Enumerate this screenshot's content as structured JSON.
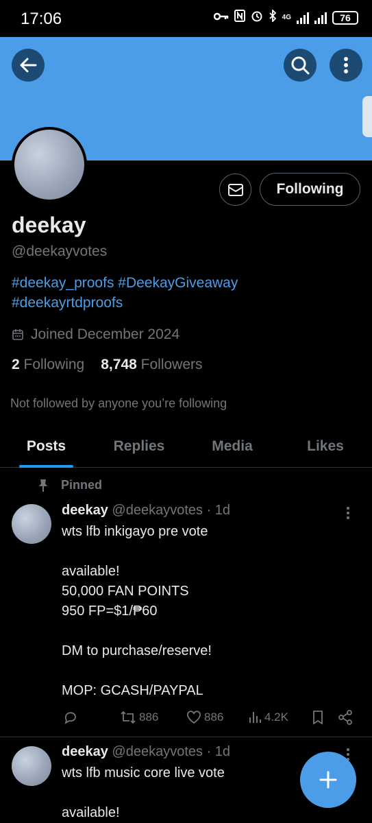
{
  "status_bar": {
    "time": "17:06",
    "network": "4G",
    "battery": "76"
  },
  "profile": {
    "name": "deekay",
    "handle": "@deekayvotes",
    "bio_line1": "#deekay_proofs #DeekayGiveaway",
    "bio_line2": "#deekayrtdproofs",
    "joined": "Joined December 2024",
    "following_count": "2",
    "following_label": "Following",
    "followers_count": "8,748",
    "followers_label": "Followers",
    "not_followed_text": "Not followed by anyone you’re following",
    "follow_button_label": "Following"
  },
  "tabs": [
    "Posts",
    "Replies",
    "Media",
    "Likes"
  ],
  "pinned_label": "Pinned",
  "posts": [
    {
      "name": "deekay",
      "handle": "@deekayvotes",
      "time": "· 1d",
      "text": "wts lfb inkigayo pre vote\n\navailable!\n50,000 FAN POINTS\n950 FP=$1/₱60\n\nDM to purchase/reserve!\n\nMOP: GCASH/PAYPAL",
      "reposts": "886",
      "likes": "886",
      "views": "4.2K"
    },
    {
      "name": "deekay",
      "handle": "@deekayvotes",
      "time": "· 1d",
      "text": "wts lfb music core live vote\n\navailable!"
    }
  ],
  "colors": {
    "banner": "#4a9de6",
    "accent": "#1d9bf0",
    "background": "#000000"
  },
  "icons": [
    "back-arrow-icon",
    "search-icon",
    "more-vertical-icon",
    "mail-icon",
    "calendar-icon",
    "pin-icon",
    "reply-icon",
    "repost-icon",
    "like-icon",
    "views-icon",
    "bookmark-icon",
    "share-icon",
    "compose-plus-icon"
  ]
}
